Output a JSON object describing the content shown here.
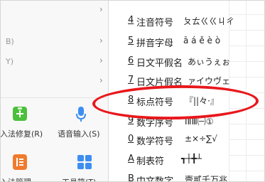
{
  "left_menu": {
    "items": [
      {
        "label": "B)",
        "chevron": "›"
      },
      {
        "label": "Y)",
        "chevron": "›"
      },
      {
        "label": "",
        "chevron": "›"
      },
      {
        "label": "",
        "chevron": "›"
      }
    ],
    "tools": [
      {
        "label": "入法修复(R)",
        "icon": "plus-bag-icon",
        "color": "#4cbf3c"
      },
      {
        "label": "语音输入(S)",
        "icon": "microphone-icon",
        "color": "#3d8ef0"
      },
      {
        "label": "入法管理",
        "icon": "list-icon",
        "color": "#f07b2c"
      },
      {
        "label": "工具箱(T)",
        "icon": "grid-icon",
        "color": "#3d8ef0"
      }
    ]
  },
  "submenu": {
    "items": [
      {
        "key": "4",
        "name": "注音符号",
        "sample": "ㄆㄊㄍㄍㄐㄔ"
      },
      {
        "key": "5",
        "name": "拼音字母",
        "sample": "ā á ě è ò"
      },
      {
        "key": "6",
        "name": "日文平假名",
        "sample": "あぃうぇぉ"
      },
      {
        "key": "7",
        "name": "日文片假名",
        "sample": "ァイウヴェ"
      },
      {
        "key": "8",
        "name": "标点符号",
        "sample": "『||々·』"
      },
      {
        "key": "9",
        "name": "数字序号",
        "sample": "ⅠⅡⅢ㈠①"
      },
      {
        "key": "0",
        "name": "数学符号",
        "sample": "±×÷∑√"
      },
      {
        "key": "A",
        "name": "制表符",
        "sample": "┱┼╋┴"
      },
      {
        "key": "B",
        "name": "中文数字",
        "sample": "壹贰千万兆"
      }
    ]
  },
  "colors": {
    "highlight": "#e8181c"
  }
}
